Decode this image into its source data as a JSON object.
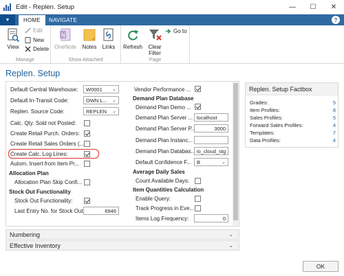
{
  "window": {
    "title": "Edit - Replen. Setup",
    "minimize": "—",
    "maximize": "☐",
    "close": "✕"
  },
  "tabs": {
    "menu": "▼",
    "home": "HOME",
    "navigate": "NAVIGATE",
    "help": "?"
  },
  "ribbon": {
    "manage": {
      "caption": "Manage",
      "view": "View",
      "edit": "Edit",
      "new": "New",
      "delete": "Delete"
    },
    "show_attached": {
      "caption": "Show Attached",
      "onenote": "OneNote",
      "notes": "Notes",
      "links": "Links"
    },
    "page": {
      "caption": "Page",
      "refresh": "Refresh",
      "clear_filter_1": "Clear",
      "clear_filter_2": "Filter",
      "goto": "Go to"
    }
  },
  "page_title": "Replen. Setup",
  "left_fields": [
    {
      "label": "Default Central Warehouse:",
      "value": "W0001",
      "type": "select"
    },
    {
      "label": "Default In-Transit Code:",
      "value": "OWN L...",
      "type": "select"
    },
    {
      "label": "Replen. Source Code:",
      "value": "REPLEN",
      "type": "select"
    },
    {
      "label": "Calc. Qty. Sold not Posted:",
      "checked": false,
      "type": "check"
    },
    {
      "label": "Create Retail Purch. Orders:",
      "checked": true,
      "type": "check"
    },
    {
      "label": "Create Retail Sales Orders (...",
      "checked": false,
      "type": "check"
    },
    {
      "label": "Create Calc. Log Lines:",
      "checked": true,
      "type": "check"
    },
    {
      "label": "Autom. Insert from Item Pr...",
      "checked": false,
      "type": "check"
    }
  ],
  "allocation": {
    "header": "Allocation Plan",
    "skip_label": "Allocation Plan Skip Confi...",
    "skip_checked": false
  },
  "stockout": {
    "header": "Stock Out Functionality",
    "func_label": "Stock Out Functionality:",
    "func_checked": true,
    "last_entry_label": "Last Entry No. for Stock Out:",
    "last_entry_value": "6946"
  },
  "right_fields": {
    "vendor_perf_label": "Vendor Performance ...",
    "vendor_perf_checked": true,
    "demand_header": "Demand Plan Database",
    "demand_demo_label": "Demand Plan Demo ...",
    "demand_demo_checked": true,
    "server1_label": "Demand Plan Server ...",
    "server1_value": "localhost",
    "server2_label": "Demand Plan Server P...",
    "server2_value": "3000",
    "instance_label": "Demand Plan Instanc...",
    "instance_value": "",
    "database_label": "Demand Plan Databas...",
    "database_value": "io_cloud_stg",
    "confidence_label": "Default Confidence F...",
    "confidence_value": "B",
    "ads_header": "Average Daily Sales",
    "count_days_label": "Count Available Days:",
    "count_days_checked": false,
    "iqc_header": "Item Quantities Calculation",
    "enable_query_label": "Enable Query:",
    "enable_query_checked": false,
    "track_label": "Track Progress in Eve...",
    "track_checked": false,
    "log_freq_label": "Items Log Frequency:",
    "log_freq_value": "0"
  },
  "fasttabs": {
    "numbering": "Numbering",
    "effective_inventory": "Effective Inventory",
    "chevron": "⌄"
  },
  "factbox": {
    "title": "Replen. Setup Factbox",
    "rows": [
      {
        "label": "Grades:",
        "value": "5"
      },
      {
        "label": "Item Profiles:",
        "value": "8"
      },
      {
        "label": "Sales Profiles:",
        "value": "5"
      },
      {
        "label": "Forward Sales Profiles:",
        "value": "4"
      },
      {
        "label": "Templates:",
        "value": "7"
      },
      {
        "label": "Data Profiles:",
        "value": "4"
      }
    ]
  },
  "ok_button": "OK",
  "colors": {
    "accent": "#2f6aa3",
    "title_blue": "#1f5f98",
    "highlight": "#e0312b"
  }
}
